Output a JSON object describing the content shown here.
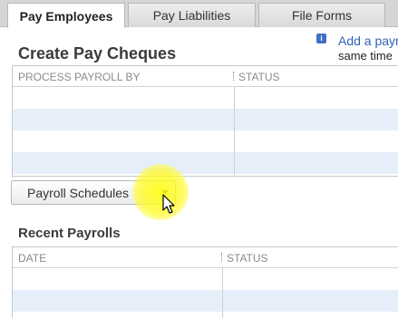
{
  "tabs": [
    {
      "label": "Pay Employees",
      "active": true
    },
    {
      "label": "Pay Liabilities",
      "active": false
    },
    {
      "label": "File Forms",
      "active": false
    }
  ],
  "create_section": {
    "title": "Create Pay Cheques",
    "columns": [
      "PROCESS PAYROLL BY",
      "STATUS"
    ]
  },
  "info_link": {
    "icon": "info-icon",
    "link_text": "Add a payr",
    "sub_text": "same time"
  },
  "payroll_schedules_button": {
    "label": "Payroll Schedules"
  },
  "recent_section": {
    "title": "Recent Payrolls",
    "columns": [
      "DATE",
      "STATUS"
    ]
  },
  "colors": {
    "link": "#2f5fb8",
    "alt_row": "#e6eefa",
    "cursor_highlight": "#ffff00"
  }
}
